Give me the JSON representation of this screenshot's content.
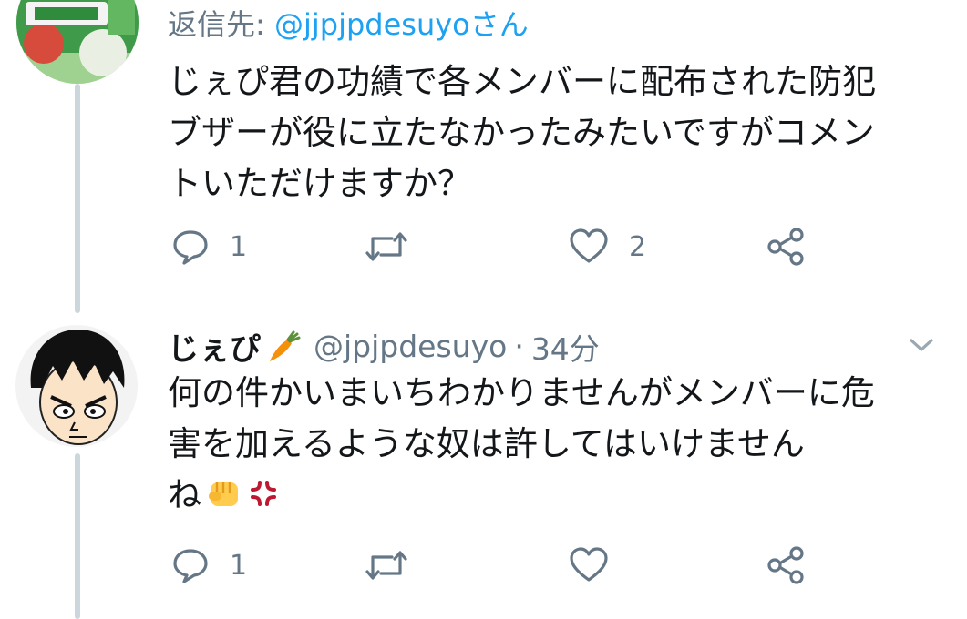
{
  "thread": {
    "parent": {
      "reply_prefix": "返信先: ",
      "reply_handle": "@jjpjpdesuyoさん",
      "text_lines": [
        "じぇぴ君の功績で各メンバーに配布された防犯",
        "ブザーが役に立たなかったみたいですがコメン",
        "トいただけますか？"
      ],
      "actions": {
        "reply_count": "1",
        "retweet_count": "",
        "like_count": "2"
      }
    },
    "reply": {
      "display_name": "じぇぴ",
      "handle": "@jpjpdesuyo",
      "separator": "·",
      "time": "34分",
      "text_lines": [
        "何の件かいまいちわかりませんがメンバーに危",
        "害を加えるような奴は許してはいけません",
        "ね"
      ],
      "actions": {
        "reply_count": "1",
        "retweet_count": "",
        "like_count": ""
      }
    }
  },
  "icons": {
    "reply": "comment-bubble-icon",
    "retweet": "retweet-icon",
    "like": "heart-icon",
    "share": "share-icon",
    "caret": "chevron-down-icon",
    "carrot": "carrot-emoji-icon",
    "fist": "fist-emoji-icon",
    "anger": "anger-symbol-emoji-icon"
  },
  "colors": {
    "primary_text": "#14171a",
    "secondary_text": "#657786",
    "link": "#1da1f2",
    "thread_line": "#ccd6dd"
  }
}
